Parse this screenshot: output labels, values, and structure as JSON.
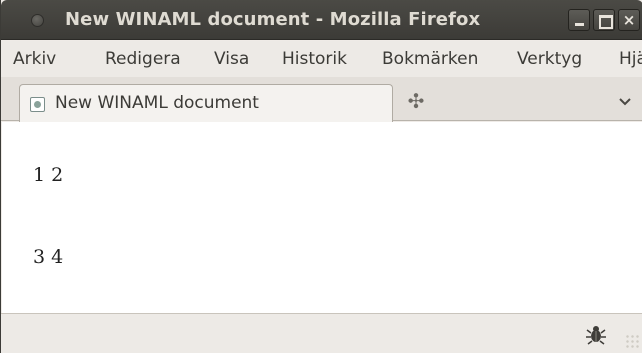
{
  "window": {
    "title": "New WINAML document - Mozilla Firefox",
    "buttons": {
      "minimize": "_",
      "maximize": "□",
      "close": "×"
    }
  },
  "menubar": {
    "items": [
      {
        "label": "Arkiv"
      },
      {
        "label": "Redigera"
      },
      {
        "label": "Visa"
      },
      {
        "label": "Historik"
      },
      {
        "label": "Bokmärken"
      },
      {
        "label": "Verktyg"
      },
      {
        "label": "Hjä"
      }
    ]
  },
  "tabs": {
    "items": [
      {
        "label": "New WINAML document",
        "icon": "page-icon"
      }
    ],
    "new_tab_glyph": "✣",
    "list_tabs_glyph": "⌄"
  },
  "content": {
    "rows": [
      {
        "text": "1 2"
      },
      {
        "text": "3 4"
      }
    ]
  },
  "statusbar": {
    "icon": "bug-icon"
  },
  "colors": {
    "titlebar": "#3c3b37",
    "title_text": "#dfdbd2",
    "chrome": "#edeae6",
    "content_bg": "#ffffff"
  }
}
